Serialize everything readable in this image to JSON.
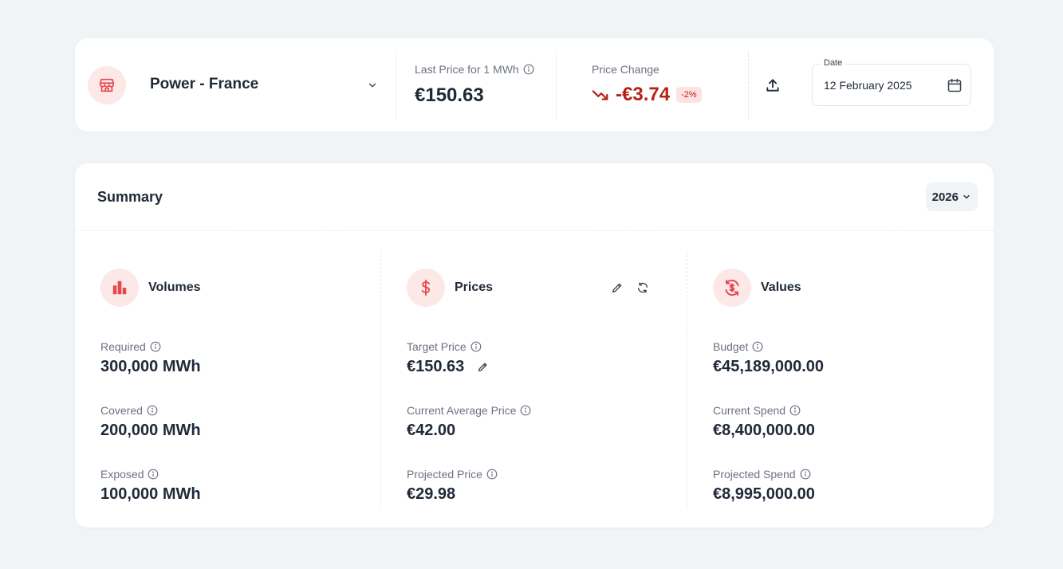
{
  "header": {
    "market": "Power - France",
    "last_price_label": "Last Price for 1 MWh",
    "last_price_value": "€150.63",
    "price_change_label": "Price Change",
    "price_change_value": "-€3.74",
    "price_change_badge": "-2%",
    "date_label": "Date",
    "date_value": "12 February 2025"
  },
  "summary": {
    "title": "Summary",
    "year": "2026",
    "volumes": {
      "title": "Volumes",
      "metrics": [
        {
          "label": "Required",
          "value": "300,000 MWh"
        },
        {
          "label": "Covered",
          "value": "200,000 MWh"
        },
        {
          "label": "Exposed",
          "value": "100,000 MWh"
        }
      ]
    },
    "prices": {
      "title": "Prices",
      "metrics": [
        {
          "label": "Target Price",
          "value": "€150.63"
        },
        {
          "label": "Current Average Price",
          "value": "€42.00"
        },
        {
          "label": "Projected Price",
          "value": "€29.98"
        }
      ]
    },
    "values": {
      "title": "Values",
      "metrics": [
        {
          "label": "Budget",
          "value": "€45,189,000.00"
        },
        {
          "label": "Current Spend",
          "value": "€8,400,000.00"
        },
        {
          "label": "Projected Spend",
          "value": "€8,995,000.00"
        }
      ]
    }
  },
  "colors": {
    "accent": "#e5484d",
    "accent_bg": "#fde8e8",
    "negative": "#b42318",
    "page_bg": "#f1f4f7"
  },
  "icons": {
    "market": "store-icon",
    "info": "info-icon",
    "trend": "trending-down-icon",
    "upload": "upload-icon",
    "calendar": "calendar-icon",
    "volumes": "bar-chart-icon",
    "prices": "dollar-icon",
    "values": "currency-exchange-icon",
    "edit": "pencil-icon",
    "refresh": "refresh-icon"
  }
}
